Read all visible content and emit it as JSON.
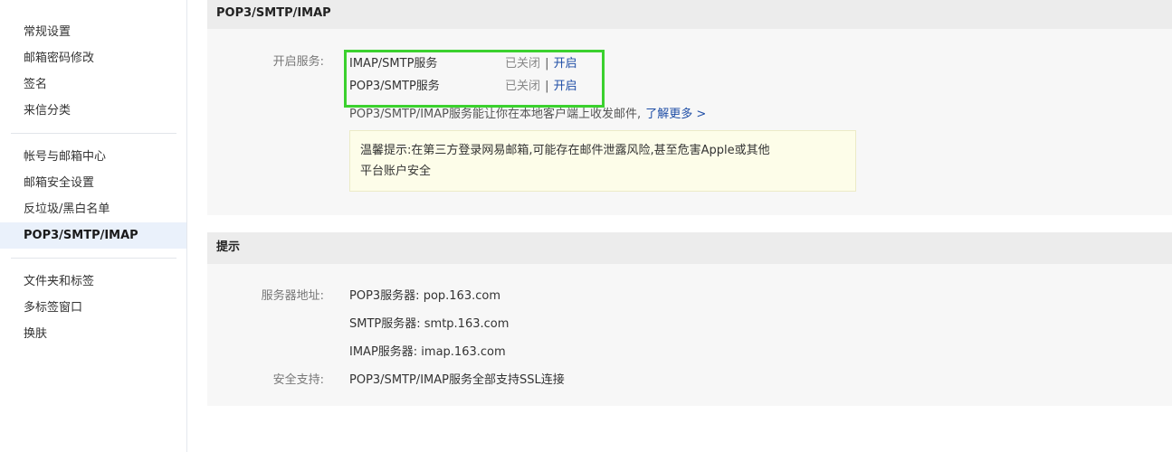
{
  "sidebar": {
    "group1": [
      "常规设置",
      "邮箱密码修改",
      "签名",
      "来信分类"
    ],
    "group2": [
      "帐号与邮箱中心",
      "邮箱安全设置",
      "反垃圾/黑白名单",
      "POP3/SMTP/IMAP"
    ],
    "group3": [
      "文件夹和标签",
      "多标签窗口",
      "换肤"
    ],
    "active": "POP3/SMTP/IMAP"
  },
  "section1": {
    "title": "POP3/SMTP/IMAP",
    "service_label": "开启服务:",
    "services": [
      {
        "name": "IMAP/SMTP服务",
        "status": "已关闭",
        "separator": "|",
        "action": "开启"
      },
      {
        "name": "POP3/SMTP服务",
        "status": "已关闭",
        "separator": "|",
        "action": "开启"
      }
    ],
    "description": "POP3/SMTP/IMAP服务能让你在本地客户端上收发邮件,",
    "learn_more": "了解更多 >",
    "tip_line1": "温馨提示:在第三方登录网易邮箱,可能存在邮件泄露风险,甚至危害Apple或其他",
    "tip_line2": "平台账户安全"
  },
  "section2": {
    "title": "提示",
    "server_label": "服务器地址:",
    "servers": [
      "POP3服务器: pop.163.com",
      "SMTP服务器: smtp.163.com",
      "IMAP服务器: imap.163.com"
    ],
    "security_label": "安全支持:",
    "security_value": "POP3/SMTP/IMAP服务全部支持SSL连接"
  },
  "colors": {
    "highlight": "#3bd12e",
    "link": "#1f4ea6",
    "active_bg": "#eaf1fb"
  }
}
